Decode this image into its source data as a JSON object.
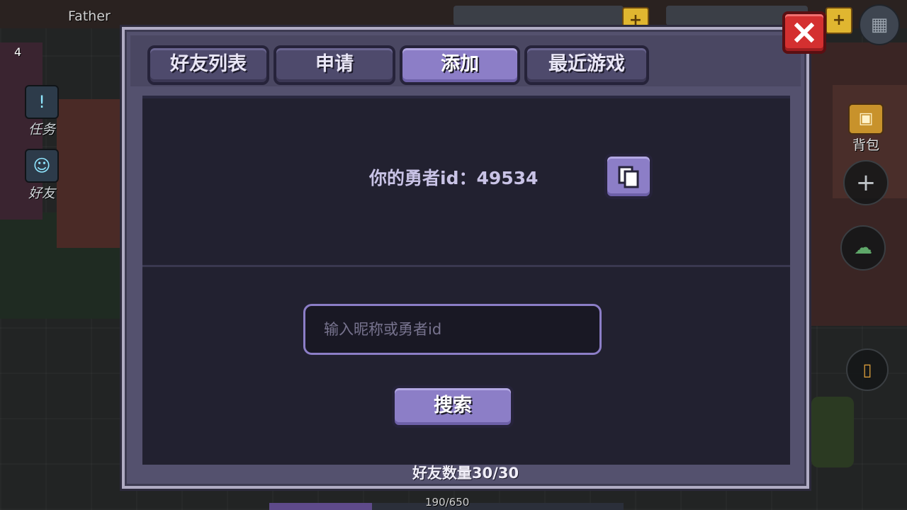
{
  "hud": {
    "player_name": "Father",
    "level": "4",
    "left_buttons": [
      {
        "label": "任务",
        "icon": "quest-icon"
      },
      {
        "label": "好友",
        "icon": "friends-icon"
      }
    ],
    "right_buttons": [
      {
        "label": "背包",
        "icon": "backpack-icon"
      }
    ],
    "hp_text": "190/650",
    "hp_fraction": 0.29
  },
  "dialog": {
    "tabs": [
      {
        "label": "好友列表",
        "active": false
      },
      {
        "label": "申请",
        "active": false
      },
      {
        "label": "添加",
        "active": true
      },
      {
        "label": "最近游戏",
        "active": false
      }
    ],
    "my_id_text": "你的勇者id：49534",
    "copy_icon": "copy-icon",
    "search": {
      "value": "",
      "placeholder": "输入昵称或勇者id",
      "button_label": "搜索"
    },
    "friend_count_text": "好友数量30/30",
    "close_icon": "close-icon"
  },
  "colors": {
    "accent": "#8c7ec7",
    "panel": "#222130",
    "close": "#d43030"
  }
}
